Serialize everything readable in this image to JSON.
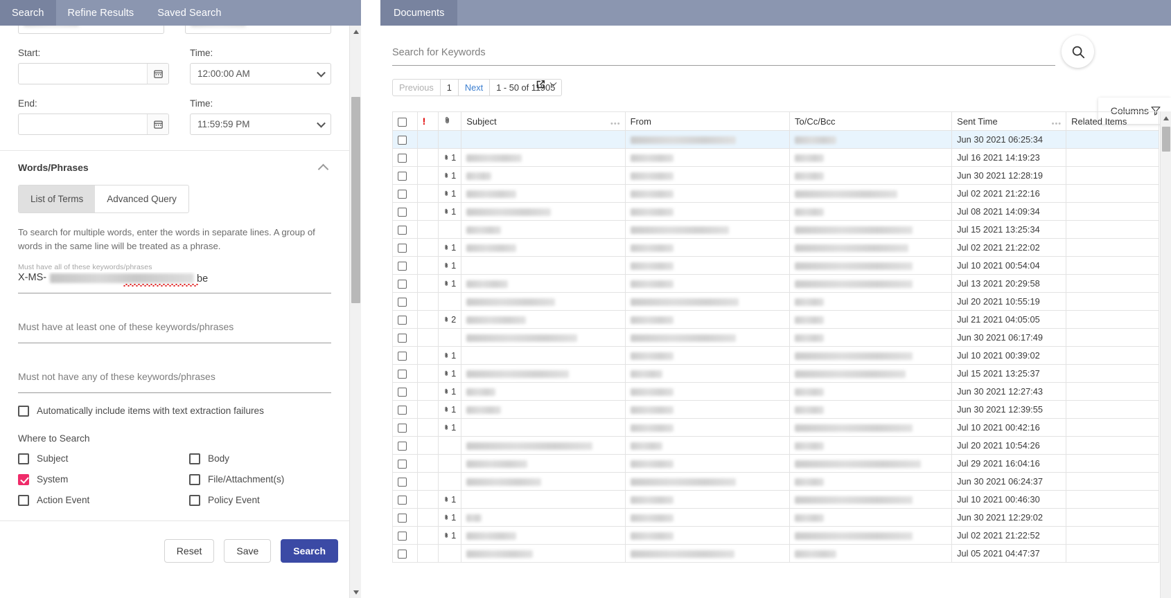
{
  "left": {
    "tabs": [
      {
        "label": "Search",
        "active": true
      },
      {
        "label": "Refine Results",
        "active": false
      },
      {
        "label": "Saved Search",
        "active": false
      }
    ],
    "date_section": {
      "start_label": "Start:",
      "start_time_label": "Time:",
      "end_label": "End:",
      "end_time_label": "Time:",
      "start_value": "",
      "end_value": "",
      "start_time_value": "12:00:00 AM",
      "end_time_value": "11:59:59 PM"
    },
    "words_phrases": {
      "title": "Words/Phrases",
      "tabs": [
        {
          "label": "List of Terms",
          "active": true
        },
        {
          "label": "Advanced Query",
          "active": false
        }
      ],
      "hint": "To search for multiple words, enter the words in separate lines. A group of words in the same line will be treated as a phrase.",
      "must_all_label": "Must have all of these keywords/phrases",
      "must_all_value_prefix": "X-MS-",
      "must_all_value_suffix": "be",
      "must_any_placeholder": "Must have at least one of these keywords/phrases",
      "must_not_placeholder": "Must not have any of these keywords/phrases"
    },
    "extraction_failures_label": "Automatically include items with text extraction failures",
    "extraction_failures_checked": false,
    "where_to_search": {
      "title": "Where to Search",
      "options": [
        {
          "label": "Subject",
          "checked": false
        },
        {
          "label": "Body",
          "checked": false
        },
        {
          "label": "System",
          "checked": true
        },
        {
          "label": "File/Attachment(s)",
          "checked": false
        },
        {
          "label": "Action Event",
          "checked": false
        },
        {
          "label": "Policy Event",
          "checked": false
        }
      ]
    },
    "footer_buttons": [
      {
        "label": "Reset",
        "primary": false
      },
      {
        "label": "Save",
        "primary": false
      },
      {
        "label": "Search",
        "primary": true
      }
    ]
  },
  "right": {
    "tab_label": "Documents",
    "search_placeholder": "Search for Keywords",
    "search_value": "",
    "pager": {
      "previous": "Previous",
      "page": "1",
      "next": "Next",
      "range": "1 - 50 of 11905"
    },
    "columns_button": "Columns",
    "table": {
      "headers": [
        "",
        "!",
        "paperclip",
        "Subject",
        "From",
        "To/Cc/Bcc",
        "Sent Time",
        "Related Items"
      ],
      "header_subject": "Subject",
      "header_from": "From",
      "header_to": "To/Cc/Bcc",
      "header_sent": "Sent Time",
      "header_related": "Related Items",
      "rows": [
        {
          "selected": true,
          "att": "",
          "subject_w": 0,
          "from_w": 152,
          "to_w": 60,
          "sent": "Jun 30 2021 06:25:34",
          "related": ""
        },
        {
          "selected": false,
          "att": "1",
          "subject_w": 80,
          "from_w": 62,
          "to_w": 42,
          "sent": "Jul 16 2021 14:19:23",
          "related": ""
        },
        {
          "selected": false,
          "att": "1",
          "subject_w": 36,
          "from_w": 62,
          "to_w": 42,
          "sent": "Jun 30 2021 12:28:19",
          "related": ""
        },
        {
          "selected": false,
          "att": "1",
          "subject_w": 72,
          "from_w": 62,
          "to_w": 148,
          "sent": "Jul 02 2021 21:22:16",
          "related": ""
        },
        {
          "selected": false,
          "att": "1",
          "subject_w": 122,
          "from_w": 62,
          "to_w": 42,
          "sent": "Jul 08 2021 14:09:34",
          "related": ""
        },
        {
          "selected": false,
          "att": "",
          "subject_w": 50,
          "from_w": 142,
          "to_w": 170,
          "sent": "Jul 15 2021 13:25:34",
          "related": ""
        },
        {
          "selected": false,
          "att": "1",
          "subject_w": 72,
          "from_w": 62,
          "to_w": 164,
          "sent": "Jul 02 2021 21:22:02",
          "related": ""
        },
        {
          "selected": false,
          "att": "1",
          "subject_w": 0,
          "from_w": 62,
          "to_w": 170,
          "sent": "Jul 10 2021 00:54:04",
          "related": ""
        },
        {
          "selected": false,
          "att": "1",
          "subject_w": 60,
          "from_w": 62,
          "to_w": 170,
          "sent": "Jul 13 2021 20:29:58",
          "related": ""
        },
        {
          "selected": false,
          "att": "",
          "subject_w": 128,
          "from_w": 156,
          "to_w": 42,
          "sent": "Jul 20 2021 10:55:19",
          "related": ""
        },
        {
          "selected": false,
          "att": "2",
          "subject_w": 86,
          "from_w": 62,
          "to_w": 42,
          "sent": "Jul 21 2021 04:05:05",
          "related": ""
        },
        {
          "selected": false,
          "att": "",
          "subject_w": 160,
          "from_w": 152,
          "to_w": 42,
          "sent": "Jun 30 2021 06:17:49",
          "related": ""
        },
        {
          "selected": false,
          "att": "1",
          "subject_w": 0,
          "from_w": 62,
          "to_w": 170,
          "sent": "Jul 10 2021 00:39:02",
          "related": ""
        },
        {
          "selected": false,
          "att": "1",
          "subject_w": 148,
          "from_w": 46,
          "to_w": 160,
          "sent": "Jul 15 2021 13:25:37",
          "related": ""
        },
        {
          "selected": false,
          "att": "1",
          "subject_w": 42,
          "from_w": 62,
          "to_w": 42,
          "sent": "Jun 30 2021 12:27:43",
          "related": ""
        },
        {
          "selected": false,
          "att": "1",
          "subject_w": 50,
          "from_w": 62,
          "to_w": 42,
          "sent": "Jun 30 2021 12:39:55",
          "related": ""
        },
        {
          "selected": false,
          "att": "1",
          "subject_w": 0,
          "from_w": 62,
          "to_w": 170,
          "sent": "Jul 10 2021 00:42:16",
          "related": ""
        },
        {
          "selected": false,
          "att": "",
          "subject_w": 182,
          "from_w": 46,
          "to_w": 42,
          "sent": "Jul 20 2021 10:54:26",
          "related": ""
        },
        {
          "selected": false,
          "att": "",
          "subject_w": 88,
          "from_w": 62,
          "to_w": 182,
          "sent": "Jul 29 2021 16:04:16",
          "related": ""
        },
        {
          "selected": false,
          "att": "",
          "subject_w": 108,
          "from_w": 152,
          "to_w": 42,
          "sent": "Jun 30 2021 06:24:37",
          "related": ""
        },
        {
          "selected": false,
          "att": "1",
          "subject_w": 0,
          "from_w": 62,
          "to_w": 170,
          "sent": "Jul 10 2021 00:46:30",
          "related": ""
        },
        {
          "selected": false,
          "att": "1",
          "subject_w": 22,
          "from_w": 62,
          "to_w": 42,
          "sent": "Jun 30 2021 12:29:02",
          "related": ""
        },
        {
          "selected": false,
          "att": "1",
          "subject_w": 72,
          "from_w": 62,
          "to_w": 170,
          "sent": "Jul 02 2021 21:22:52",
          "related": ""
        },
        {
          "selected": false,
          "att": "",
          "subject_w": 96,
          "from_w": 150,
          "to_w": 60,
          "sent": "Jul 05 2021 04:47:37",
          "related": ""
        }
      ]
    }
  }
}
